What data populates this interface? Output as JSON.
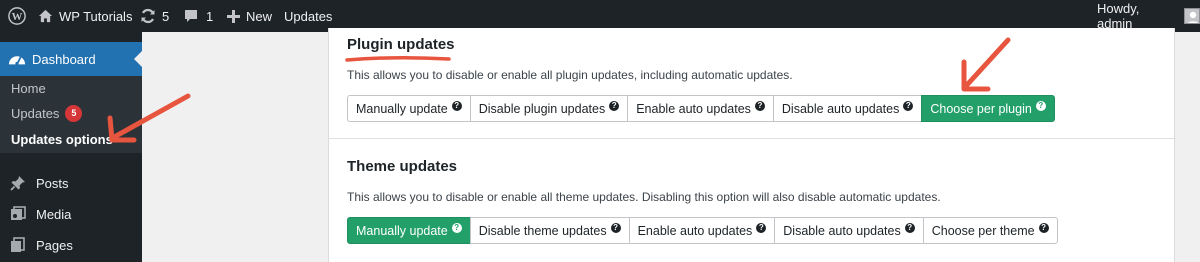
{
  "adminbar": {
    "site_name": "WP Tutorials",
    "updates_count": "5",
    "comments_count": "1",
    "new_label": "New",
    "updates_label": "Updates",
    "howdy": "Howdy, admin",
    "icons": [
      "wordpress-logo-icon",
      "home-icon",
      "refresh-icon",
      "comment-icon",
      "plus-icon"
    ],
    "background": "#1d2327"
  },
  "sidebar": {
    "dashboard_label": "Dashboard",
    "submenu": {
      "home": "Home",
      "updates": "Updates",
      "updates_badge": "5",
      "updates_options": "Updates options"
    },
    "items": [
      {
        "label": "Posts",
        "icon": "pin-icon"
      },
      {
        "label": "Media",
        "icon": "media-icon"
      },
      {
        "label": "Pages",
        "icon": "pages-icon"
      }
    ],
    "active_color": "#2271b1"
  },
  "plugin_section": {
    "title": "Plugin updates",
    "description": "This allows you to disable or enable all plugin updates, including automatic updates.",
    "options": [
      {
        "label": "Manually update",
        "active": false
      },
      {
        "label": "Disable plugin updates",
        "active": false
      },
      {
        "label": "Enable auto updates",
        "active": false
      },
      {
        "label": "Disable auto updates",
        "active": false
      },
      {
        "label": "Choose per plugin",
        "active": true
      }
    ]
  },
  "theme_section": {
    "title": "Theme updates",
    "description": "This allows you to disable or enable all theme updates. Disabling this option will also disable automatic updates.",
    "options": [
      {
        "label": "Manually update",
        "active": true
      },
      {
        "label": "Disable theme updates",
        "active": false
      },
      {
        "label": "Enable auto updates",
        "active": false
      },
      {
        "label": "Disable auto updates",
        "active": false
      },
      {
        "label": "Choose per theme",
        "active": false
      }
    ]
  },
  "help_glyph": "?",
  "colors": {
    "active_button": "#23a06a",
    "annotation": "#e8553f"
  }
}
